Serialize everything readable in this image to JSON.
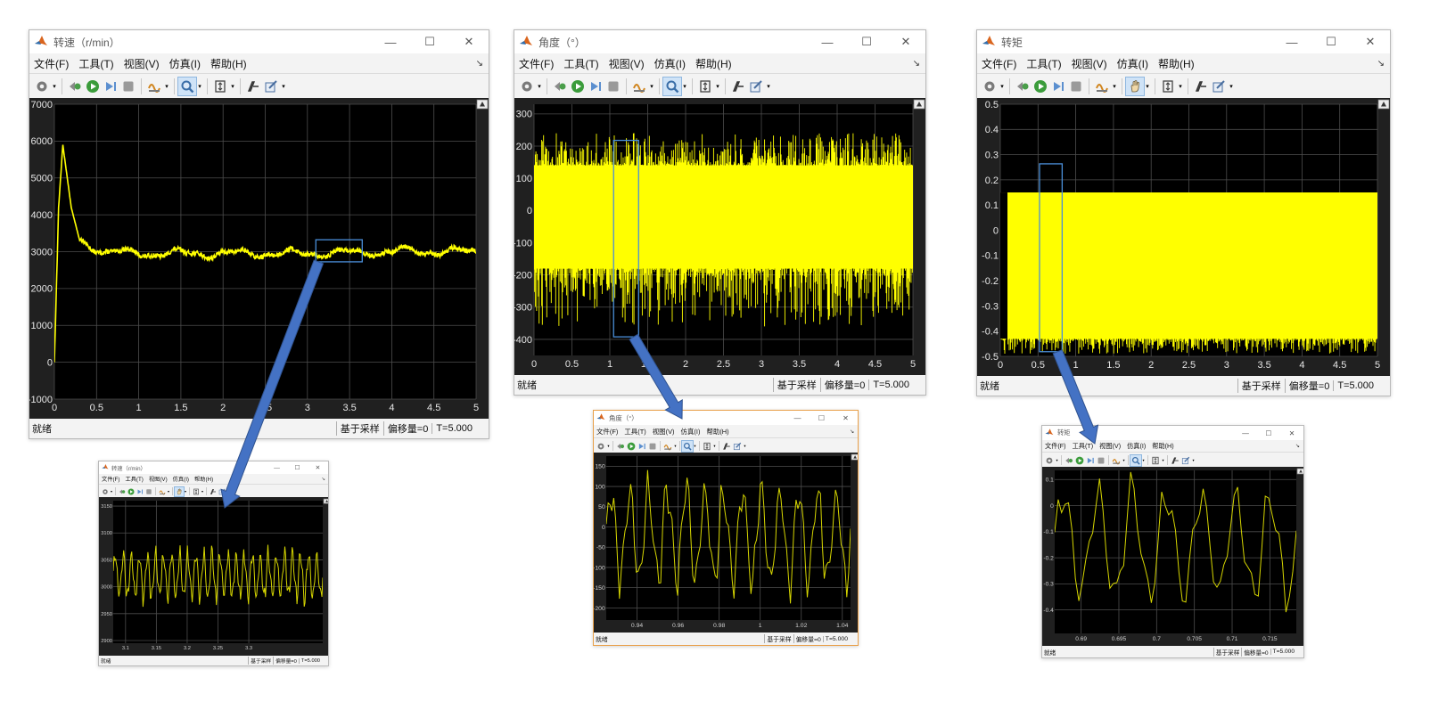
{
  "windows": [
    {
      "id": "w1",
      "title": "转速（r/min）",
      "menu": [
        "文件(F)",
        "工具(T)",
        "视图(V)",
        "仿真(I)",
        "帮助(H)"
      ],
      "collapse_icon": "↘",
      "toolbar_icons": [
        "gear-icon",
        "dropdown",
        "sep",
        "step-back-icon",
        "run-icon",
        "step-forward-icon",
        "stop-icon",
        "sep",
        "signal-icon",
        "dropdown",
        "sep",
        "zoom-icon",
        "dropdown",
        "sep",
        "fit-icon",
        "dropdown",
        "sep",
        "measure-icon",
        "style-icon",
        "dropdown"
      ],
      "status": {
        "ready": "就绪",
        "mode": "基于采样",
        "offset": "偏移量=0",
        "time": "T=5.000"
      },
      "colors": {
        "trace": "#ffff00",
        "axes_bg": "#000000",
        "grid": "#4d4d4d",
        "ticks": "#e6e6e6"
      },
      "chart_data": {
        "type": "line",
        "xlim": [
          0,
          5
        ],
        "ylim": [
          -1000,
          7000
        ],
        "xticks": [
          "0",
          "0.5",
          "1",
          "1.5",
          "2",
          "2.5",
          "3",
          "3.5",
          "4",
          "4.5",
          "5"
        ],
        "yticks": [
          "-1000",
          "0",
          "1000",
          "2000",
          "3000",
          "4000",
          "5000",
          "6000",
          "7000"
        ],
        "grid": true,
        "kind": "speed",
        "series": [
          {
            "x": [
              0,
              0.05,
              0.1,
              0.2,
              0.3,
              0.6,
              1.0,
              2.0,
              3.0,
              4.0,
              5.0
            ],
            "y": [
              0,
              4200,
              5900,
              4200,
              3300,
              3000,
              2950,
              2950,
              2950,
              3000,
              3000
            ]
          }
        ]
      }
    },
    {
      "id": "w2",
      "title": "角度（°）",
      "menu": [
        "文件(F)",
        "工具(T)",
        "视图(V)",
        "仿真(I)",
        "帮助(H)"
      ],
      "collapse_icon": "↘",
      "toolbar_icons": [
        "gear-icon",
        "dropdown",
        "sep",
        "step-back-icon",
        "run-icon",
        "step-forward-icon",
        "stop-icon",
        "sep",
        "signal-icon",
        "dropdown",
        "sep",
        "zoom-icon",
        "dropdown",
        "sep",
        "fit-icon",
        "dropdown",
        "sep",
        "measure-icon",
        "style-icon",
        "dropdown"
      ],
      "status": {
        "ready": "就绪",
        "mode": "基于采样",
        "offset": "偏移量=0",
        "time": "T=5.000"
      },
      "colors": {
        "trace": "#ffff00",
        "axes_bg": "#000000",
        "grid": "#4d4d4d",
        "ticks": "#e6e6e6"
      },
      "chart_data": {
        "type": "line",
        "xlim": [
          0,
          5
        ],
        "ylim": [
          -450,
          330
        ],
        "xticks": [
          "0",
          "0.5",
          "1",
          "1.5",
          "2",
          "2.5",
          "3",
          "3.5",
          "4",
          "4.5",
          "5"
        ],
        "yticks": [
          "300",
          "200",
          "100",
          "0",
          "-100",
          "-200",
          "-300",
          "-400"
        ],
        "grid": true,
        "kind": "band",
        "band": {
          "upper": 140,
          "lower": -180,
          "peak_max": 240,
          "peak_min": -360
        }
      }
    },
    {
      "id": "w3",
      "title": "转矩",
      "menu": [
        "文件(F)",
        "工具(T)",
        "视图(V)",
        "仿真(I)",
        "帮助(H)"
      ],
      "collapse_icon": "↘",
      "toolbar_icons": [
        "gear-icon",
        "dropdown",
        "sep",
        "step-back-icon",
        "run-icon",
        "step-forward-icon",
        "stop-icon",
        "sep",
        "signal-icon",
        "dropdown",
        "sep",
        "pan-icon",
        "dropdown",
        "sep",
        "fit-icon",
        "dropdown",
        "sep",
        "measure-icon",
        "style-icon",
        "dropdown"
      ],
      "status": {
        "ready": "就绪",
        "mode": "基于采样",
        "offset": "偏移量=0",
        "time": "T=5.000"
      },
      "colors": {
        "trace": "#ffff00",
        "axes_bg": "#000000",
        "grid": "#4d4d4d",
        "ticks": "#e6e6e6"
      },
      "chart_data": {
        "type": "line",
        "xlim": [
          0,
          5
        ],
        "ylim": [
          -0.5,
          0.5
        ],
        "xticks": [
          "0",
          "0.5",
          "1",
          "1.5",
          "2",
          "2.5",
          "3",
          "3.5",
          "4",
          "4.5",
          "5"
        ],
        "yticks": [
          "0.5",
          "0.4",
          "0.3",
          "0.2",
          "0.1",
          "0",
          "-0.1",
          "-0.2",
          "-0.3",
          "-0.4",
          "-0.5"
        ],
        "grid": true,
        "kind": "band",
        "band": {
          "upper": 0.15,
          "lower": -0.43,
          "peak_max": 0.15,
          "peak_min": -0.49
        }
      }
    },
    {
      "id": "w4",
      "title": "转速（r/min）",
      "menu": [
        "文件(F)",
        "工具(T)",
        "视图(V)",
        "仿真(I)",
        "帮助(H)"
      ],
      "collapse_icon": "↘",
      "toolbar_icons": [
        "gear-icon",
        "dropdown",
        "sep",
        "step-back-icon",
        "run-icon",
        "step-forward-icon",
        "stop-icon",
        "sep",
        "signal-icon",
        "dropdown",
        "sep",
        "pan-icon",
        "dropdown",
        "sep",
        "fit-icon",
        "dropdown",
        "sep",
        "measure-icon",
        "style-icon",
        "dropdown"
      ],
      "status": {
        "ready": "就绪",
        "mode": "基于采样",
        "offset": "偏移量=0",
        "time": "T=5.000"
      },
      "colors": {
        "trace": "#d6d600",
        "axes_bg": "#000000",
        "grid": "#4d4d4d",
        "ticks": "#d0d0d0"
      },
      "chart_data": {
        "type": "line",
        "xlim": [
          3.08,
          3.42
        ],
        "ylim": [
          2895,
          3160
        ],
        "xticks": [
          "3.1",
          "3.15",
          "3.2",
          "3.25",
          "3.3"
        ],
        "yticks": [
          "3150",
          "3100",
          "3050",
          "3000",
          "2950",
          "2900"
        ],
        "grid": true,
        "kind": "osc",
        "osc": {
          "center": 3020,
          "amp": 55,
          "cycles": 26,
          "seed": 7
        }
      }
    },
    {
      "id": "w5",
      "title": "角度（°）",
      "menu": [
        "文件(F)",
        "工具(T)",
        "视图(V)",
        "仿真(I)",
        "帮助(H)"
      ],
      "collapse_icon": "↘",
      "toolbar_icons": [
        "gear-icon",
        "dropdown",
        "sep",
        "step-back-icon",
        "run-icon",
        "step-forward-icon",
        "stop-icon",
        "sep",
        "signal-icon",
        "dropdown",
        "sep",
        "zoom-icon",
        "dropdown",
        "sep",
        "fit-icon",
        "dropdown",
        "sep",
        "measure-icon",
        "style-icon",
        "dropdown"
      ],
      "status": {
        "ready": "就绪",
        "mode": "基于采样",
        "offset": "偏移量=0",
        "time": "T=5.000"
      },
      "colors": {
        "trace": "#d6d600",
        "axes_bg": "#000000",
        "grid": "#4d4d4d",
        "ticks": "#d0d0d0"
      },
      "chart_data": {
        "type": "line",
        "xlim": [
          0.925,
          1.044
        ],
        "ylim": [
          -230,
          175
        ],
        "xticks": [
          "0.94",
          "0.96",
          "0.98",
          "1",
          "1.02",
          "1.04"
        ],
        "yticks": [
          "150",
          "100",
          "50",
          "0",
          "-50",
          "-100",
          "-150",
          "-200"
        ],
        "grid": true,
        "kind": "osc",
        "osc": {
          "center": -20,
          "amp": 160,
          "cycles": 13,
          "seed": 11
        }
      }
    },
    {
      "id": "w6",
      "title": "转矩",
      "menu": [
        "文件(F)",
        "工具(T)",
        "视图(V)",
        "仿真(I)",
        "帮助(H)"
      ],
      "collapse_icon": "↘",
      "toolbar_icons": [
        "gear-icon",
        "dropdown",
        "sep",
        "step-back-icon",
        "run-icon",
        "step-forward-icon",
        "stop-icon",
        "sep",
        "signal-icon",
        "dropdown",
        "sep",
        "zoom-icon",
        "dropdown",
        "sep",
        "fit-icon",
        "dropdown",
        "sep",
        "measure-icon",
        "style-icon",
        "dropdown"
      ],
      "status": {
        "ready": "就绪",
        "mode": "基于采样",
        "offset": "偏移量=0",
        "time": "T=5.000"
      },
      "colors": {
        "trace": "#d6d600",
        "axes_bg": "#000000",
        "grid": "#4d4d4d",
        "ticks": "#d0d0d0"
      },
      "chart_data": {
        "type": "line",
        "xlim": [
          0.6865,
          0.7185
        ],
        "ylim": [
          -0.49,
          0.135
        ],
        "xticks": [
          "0.69",
          "0.695",
          "0.7",
          "0.705",
          "0.71",
          "0.715"
        ],
        "yticks": [
          "0.1",
          "0",
          "-0.1",
          "-0.2",
          "-0.3",
          "-0.4"
        ],
        "grid": true,
        "kind": "osc",
        "osc": {
          "center": -0.15,
          "amp": 0.28,
          "cycles": 7,
          "seed": 5
        }
      }
    }
  ],
  "annotations": {
    "arrow_color": "#4472c4",
    "arrow_edge": "#2f528f",
    "zoom_box_color": "#4a8ed8"
  }
}
